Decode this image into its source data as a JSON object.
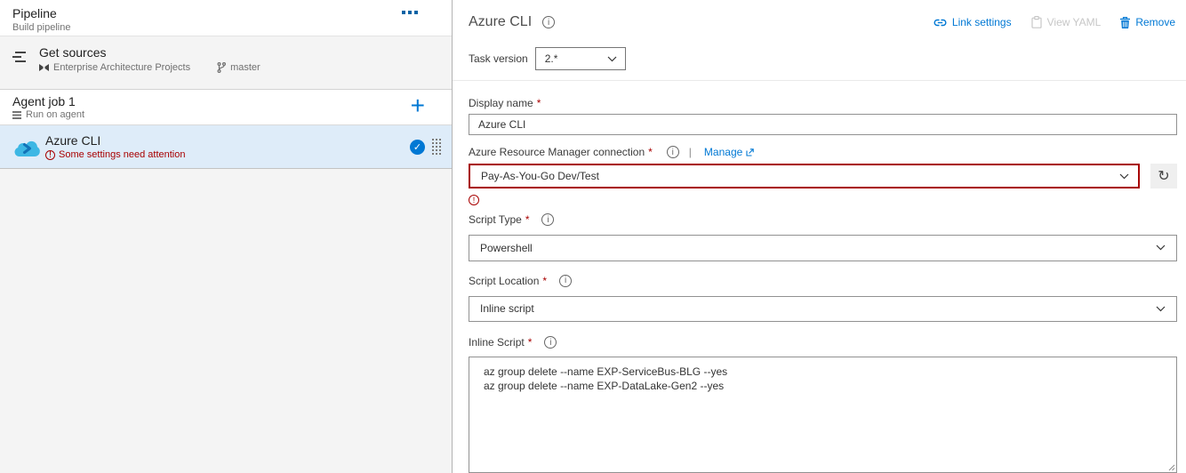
{
  "ui": {
    "required_marker": "*",
    "separator": "|"
  },
  "colors": {
    "accent_blue": "#0078d4",
    "error_red": "#a80000",
    "selected_row_bg": "#deecf9",
    "panel_gray": "#f4f4f4",
    "disabled_gray": "#c7c7c7",
    "cloud_icon_blue": "#3db7e4"
  },
  "left_panel": {
    "header": {
      "title": "Pipeline",
      "subtitle": "Build pipeline"
    },
    "get_sources": {
      "title": "Get sources",
      "repo_name": "Enterprise Architecture Projects",
      "branch_name": "master"
    },
    "agent_job": {
      "title": "Agent job 1",
      "subtitle": "Run on agent",
      "add_button": "+"
    },
    "task": {
      "title": "Azure CLI",
      "warning": "Some settings need attention",
      "status_check": "✓"
    }
  },
  "right_panel": {
    "title": "Azure CLI",
    "actions": {
      "link_settings": "Link settings",
      "view_yaml": "View YAML",
      "remove": "Remove"
    },
    "task_version": {
      "label": "Task version",
      "value": "2.*"
    },
    "fields": {
      "display_name": {
        "label": "Display name",
        "value": "Azure CLI"
      },
      "arm_connection": {
        "label": "Azure Resource Manager connection",
        "manage_label": "Manage",
        "value": "Pay-As-You-Go Dev/Test"
      },
      "script_type": {
        "label": "Script Type",
        "value": "Powershell"
      },
      "script_location": {
        "label": "Script Location",
        "value": "Inline script"
      },
      "inline_script": {
        "label": "Inline Script",
        "value": "az group delete --name EXP-ServiceBus-BLG --yes\naz group delete --name EXP-DataLake-Gen2 --yes"
      }
    }
  }
}
